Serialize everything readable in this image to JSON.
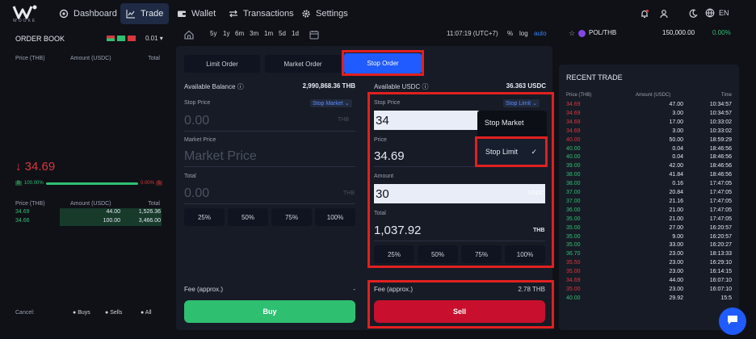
{
  "brand": {
    "name": "WOOKE"
  },
  "nav": {
    "items": [
      {
        "label": "Dashboard",
        "icon": "dashboard-icon"
      },
      {
        "label": "Trade",
        "icon": "chart-line-icon"
      },
      {
        "label": "Wallet",
        "icon": "wallet-icon"
      },
      {
        "label": "Transactions",
        "icon": "swap-icon"
      },
      {
        "label": "Settings",
        "icon": "gear-icon"
      }
    ],
    "lang": "EN"
  },
  "orderbook": {
    "title": "ORDER BOOK",
    "precision": "0.01",
    "headers": [
      "Price (THB)",
      "Amount (USDC)",
      "Total"
    ],
    "last_price": "34.69",
    "bar_left": "B",
    "bar_left_pct": "100.00%",
    "bar_right_pct": "0.00%",
    "bar_right": "S",
    "rows": [
      {
        "price": "34.69",
        "amount": "44.00",
        "total": "1,526.36"
      },
      {
        "price": "34.66",
        "amount": "100.00",
        "total": "3,466.00"
      }
    ],
    "cancel_label": "Cancel:",
    "cancel_buys": "Buys",
    "cancel_sells": "Sells",
    "cancel_all": "All"
  },
  "timebar": {
    "ranges": [
      "5y",
      "1y",
      "6m",
      "3m",
      "1m",
      "5d",
      "1d"
    ],
    "time": "11:07:19 (UTC+7)",
    "pct": "%",
    "log": "log",
    "auto": "auto"
  },
  "tabs": {
    "limit": "Limit Order",
    "market": "Market Order",
    "stop": "Stop Order"
  },
  "buy": {
    "balance_label": "Available Balance",
    "balance_value": "2,990,868.36 THB",
    "stop_price_label": "Stop Price",
    "stop_type": "Stop Market",
    "stop_price_value": "0.00",
    "currency": "THB",
    "market_price_label": "Market Price",
    "market_price_placeholder": "Market Price",
    "total_label": "Total",
    "total_value": "0.00",
    "pcts": [
      "25%",
      "50%",
      "75%",
      "100%"
    ],
    "fee_label": "Fee (approx.)",
    "fee_value": "-",
    "button": "Buy"
  },
  "sell": {
    "available_label": "Available USDC",
    "available_value": "36.363 USDC",
    "stop_price_label": "Stop Price",
    "stop_type": "Stop Limit",
    "stop_price_value": "34",
    "price_label": "Price",
    "price_value": "34.69",
    "amount_label": "Amount",
    "amount_value": "30",
    "amount_unit": "USDC",
    "total_label": "Total",
    "total_value": "1,037.92",
    "total_unit": "THB",
    "pcts": [
      "25%",
      "50%",
      "75%",
      "100%"
    ],
    "fee_label": "Fee (approx.)",
    "fee_value": "2.78 THB",
    "button": "Sell",
    "dropdown": {
      "option1": "Stop Market",
      "option2": "Stop Limit"
    }
  },
  "ticker": {
    "pair": "POL/THB",
    "price": "150,000.00",
    "change": "0.00%"
  },
  "recent": {
    "title": "RECENT TRADE",
    "headers": [
      "Price (THB)",
      "Amount (USDC)",
      "Time"
    ],
    "rows": [
      {
        "p": "34.69",
        "a": "47.00",
        "t": "10:34:57",
        "side": "red"
      },
      {
        "p": "34.69",
        "a": "3.00",
        "t": "10:34:57",
        "side": "red"
      },
      {
        "p": "34.69",
        "a": "17.00",
        "t": "10:33:02",
        "side": "red"
      },
      {
        "p": "34.69",
        "a": "3.00",
        "t": "10:33:02",
        "side": "red"
      },
      {
        "p": "40.00",
        "a": "50.00",
        "t": "18:59:29",
        "side": "red"
      },
      {
        "p": "40.00",
        "a": "0.04",
        "t": "18:46:56",
        "side": "green"
      },
      {
        "p": "40.00",
        "a": "0.04",
        "t": "18:46:56",
        "side": "green"
      },
      {
        "p": "39.00",
        "a": "42.00",
        "t": "18:46:56",
        "side": "green"
      },
      {
        "p": "38.00",
        "a": "41.84",
        "t": "18:46:56",
        "side": "green"
      },
      {
        "p": "38.00",
        "a": "0.16",
        "t": "17:47:05",
        "side": "green"
      },
      {
        "p": "37.00",
        "a": "20.84",
        "t": "17:47:05",
        "side": "green"
      },
      {
        "p": "37.00",
        "a": "21.16",
        "t": "17:47:05",
        "side": "green"
      },
      {
        "p": "36.00",
        "a": "21.00",
        "t": "17:47:05",
        "side": "green"
      },
      {
        "p": "35.00",
        "a": "21.00",
        "t": "17:47:05",
        "side": "green"
      },
      {
        "p": "35.00",
        "a": "27.00",
        "t": "16:20:57",
        "side": "green"
      },
      {
        "p": "35.00",
        "a": "9.00",
        "t": "16:20:57",
        "side": "green"
      },
      {
        "p": "35.00",
        "a": "33.00",
        "t": "16:20:27",
        "side": "green"
      },
      {
        "p": "36.70",
        "a": "23.00",
        "t": "18:13:33",
        "side": "green"
      },
      {
        "p": "35.50",
        "a": "23.00",
        "t": "16:29:10",
        "side": "red"
      },
      {
        "p": "35.00",
        "a": "23.00",
        "t": "16:14:15",
        "side": "red"
      },
      {
        "p": "34.69",
        "a": "44.00",
        "t": "16:07:10",
        "side": "red"
      },
      {
        "p": "35.00",
        "a": "23.00",
        "t": "16:07:10",
        "side": "red"
      },
      {
        "p": "40.00",
        "a": "29.92",
        "t": "15:5",
        "side": "green"
      }
    ]
  },
  "colors": {
    "accent": "#1f5bff",
    "green": "#2fbf71",
    "red": "#d6383d",
    "buy_btn": "#2fbf71",
    "sell_btn": "#c8102e",
    "highlight": "#e02020"
  }
}
